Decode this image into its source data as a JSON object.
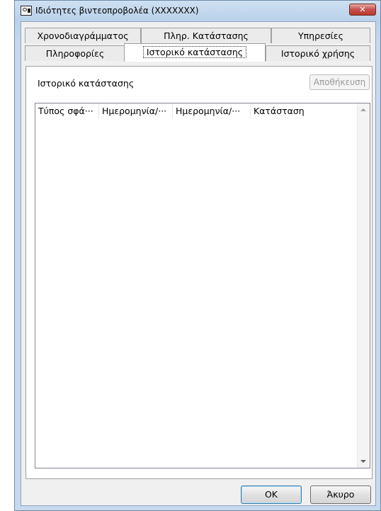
{
  "window": {
    "title": "Ιδιότητες βιντεοπροβολέα (XXXXXXX)",
    "close_label": "✕"
  },
  "tabs": {
    "row_top": [
      "Χρονοδιαγράμματος",
      "Πληρ. Κατάστασης",
      "Υπηρεσίες"
    ],
    "row_bottom": [
      "Πληροφορίες",
      "Ιστορικό κατάστασης",
      "Ιστορικό χρήσης"
    ],
    "active": "Ιστορικό κατάστασης"
  },
  "page": {
    "section_label": "Ιστορικό κατάστασης",
    "save_label": "Αποθήκευση",
    "columns": [
      "Τύπος σφά···",
      "Ημερομηνία/···",
      "Ημερομηνία/···",
      "Κατάσταση"
    ],
    "rows": []
  },
  "footer": {
    "ok_label": "OK",
    "cancel_label": "Άκυρο"
  },
  "icons": {
    "app": "projector-icon",
    "close": "close-icon",
    "scroll_up": "scroll-up-arrow-icon",
    "scroll_down": "scroll-down-arrow-icon"
  }
}
